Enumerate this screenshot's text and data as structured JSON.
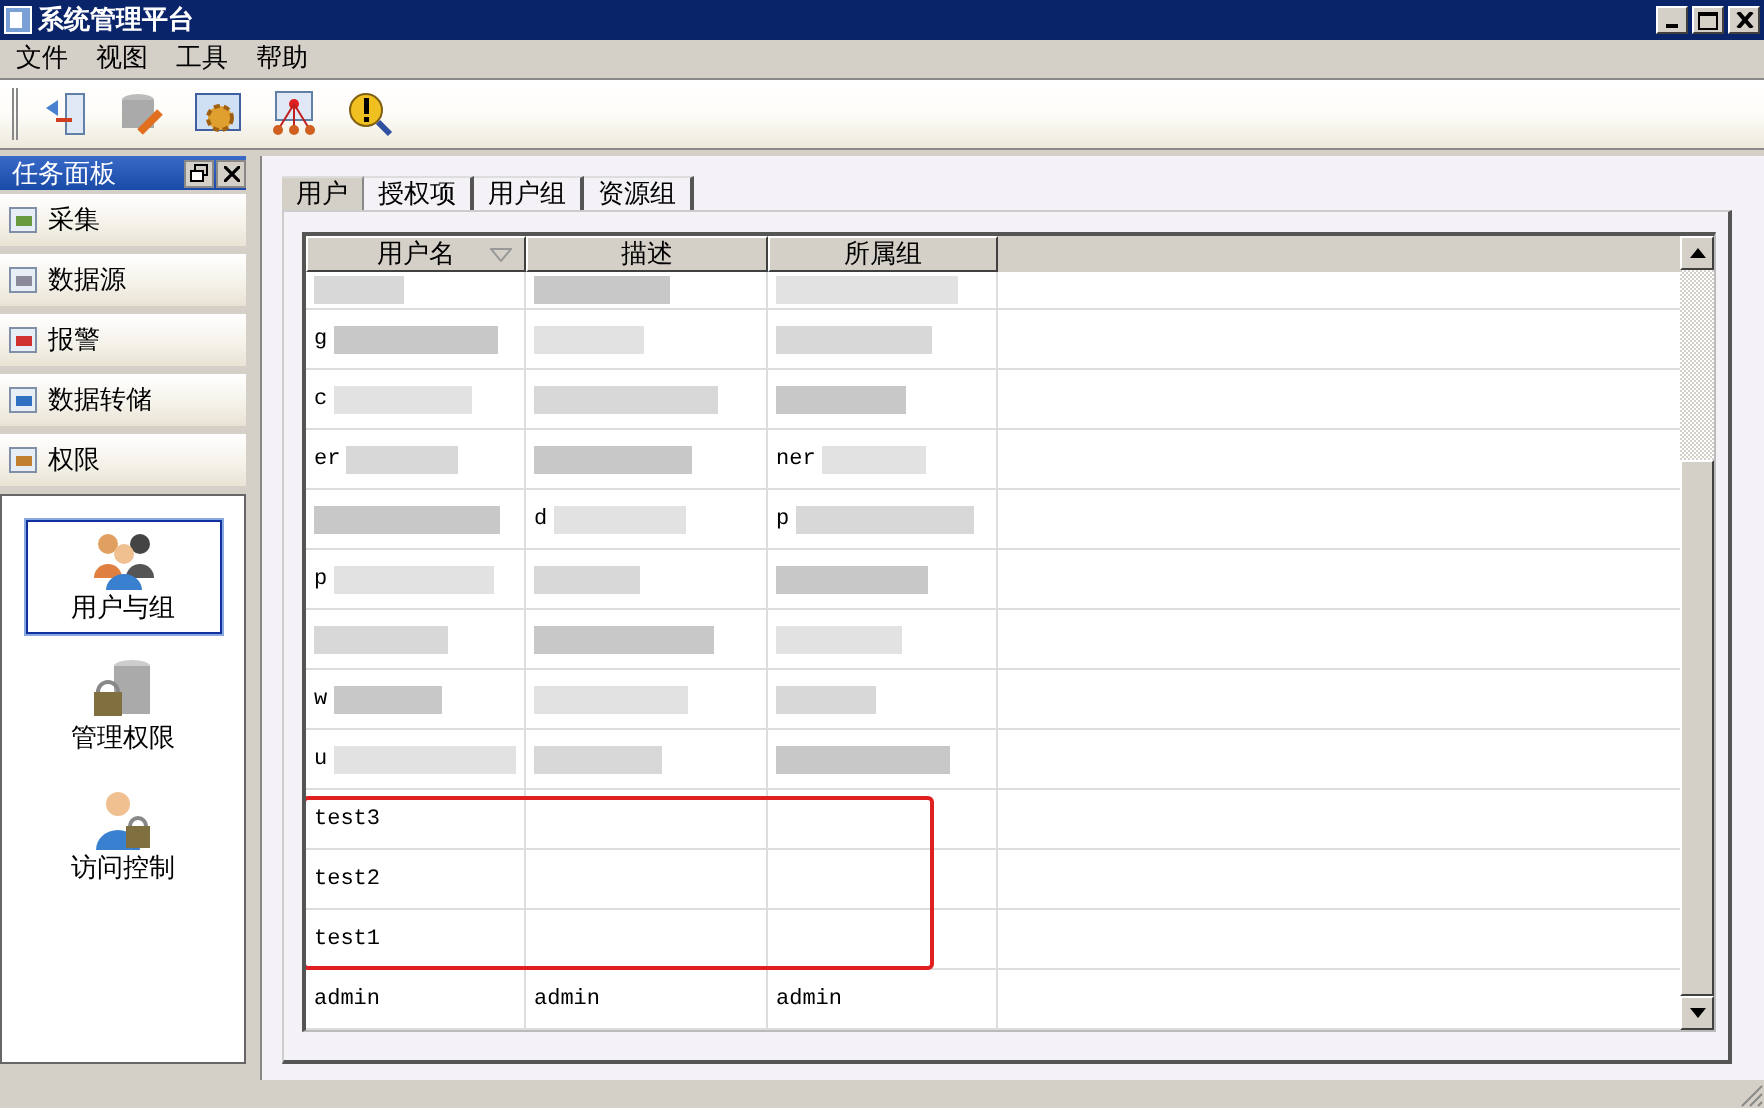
{
  "window": {
    "title": "系统管理平台"
  },
  "menu": [
    "文件",
    "视图",
    "工具",
    "帮助"
  ],
  "task_panel": {
    "title": "任务面板",
    "sections": [
      {
        "label": "采集",
        "kind": "collect"
      },
      {
        "label": "数据源",
        "kind": "source"
      },
      {
        "label": "报警",
        "kind": "alarm"
      },
      {
        "label": "数据转储",
        "kind": "dump"
      },
      {
        "label": "权限",
        "kind": "permission"
      }
    ],
    "items": [
      {
        "label": "用户与组",
        "kind": "users",
        "selected": true
      },
      {
        "label": "管理权限",
        "kind": "manage",
        "selected": false
      },
      {
        "label": "访问控制",
        "kind": "access",
        "selected": false
      }
    ]
  },
  "tabs": [
    {
      "label": "用户",
      "selected": true
    },
    {
      "label": "授权项",
      "selected": false
    },
    {
      "label": "用户组",
      "selected": false
    },
    {
      "label": "资源组",
      "selected": false
    }
  ],
  "table": {
    "columns": [
      "用户名",
      "描述",
      "所属组"
    ],
    "rows": [
      {
        "cells": [
          "",
          "",
          ""
        ],
        "redacted": true,
        "highlighted": false
      },
      {
        "cells": [
          "g",
          "",
          ""
        ],
        "redacted": true,
        "highlighted": false
      },
      {
        "cells": [
          "c",
          "",
          ""
        ],
        "redacted": true,
        "highlighted": false
      },
      {
        "cells": [
          "er",
          "",
          "ner"
        ],
        "redacted": true,
        "highlighted": false
      },
      {
        "cells": [
          "",
          "d",
          "p"
        ],
        "redacted": true,
        "highlighted": false
      },
      {
        "cells": [
          "p",
          "",
          ""
        ],
        "redacted": true,
        "highlighted": false
      },
      {
        "cells": [
          "",
          "",
          ""
        ],
        "redacted": true,
        "highlighted": false
      },
      {
        "cells": [
          "w",
          "",
          ""
        ],
        "redacted": true,
        "highlighted": false
      },
      {
        "cells": [
          "u",
          "",
          ""
        ],
        "redacted": true,
        "highlighted": false
      },
      {
        "cells": [
          "test3",
          "",
          ""
        ],
        "redacted": false,
        "highlighted": true
      },
      {
        "cells": [
          "test2",
          "",
          ""
        ],
        "redacted": false,
        "highlighted": true
      },
      {
        "cells": [
          "test1",
          "",
          ""
        ],
        "redacted": false,
        "highlighted": true
      },
      {
        "cells": [
          "admin",
          "admin",
          "admin"
        ],
        "redacted": false,
        "highlighted": false
      }
    ]
  }
}
